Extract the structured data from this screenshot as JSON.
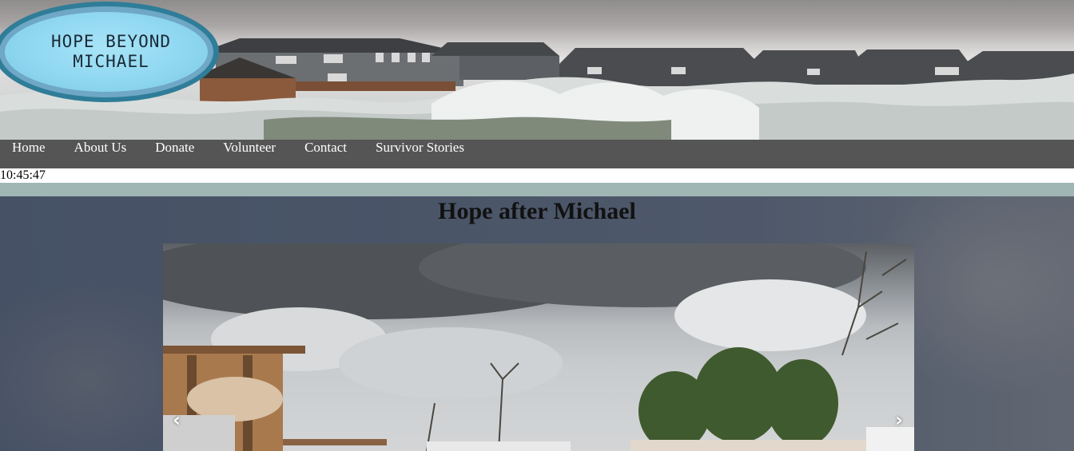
{
  "site": {
    "logo_text": "HOPE BEYOND MICHAEL"
  },
  "nav": {
    "items": [
      {
        "label": "Home"
      },
      {
        "label": "About Us"
      },
      {
        "label": "Donate"
      },
      {
        "label": "Volunteer"
      },
      {
        "label": "Contact"
      },
      {
        "label": "Survivor Stories"
      }
    ]
  },
  "clock": {
    "time": "10:45:47"
  },
  "main": {
    "title": "Hope after Michael"
  },
  "carousel": {
    "prev_icon": "‹",
    "next_icon": "›"
  },
  "colors": {
    "nav_bg": "#555555",
    "divider": "#9fb6b4",
    "logo_ring": "#2f7d98",
    "logo_fill": "#8fd7f1"
  }
}
